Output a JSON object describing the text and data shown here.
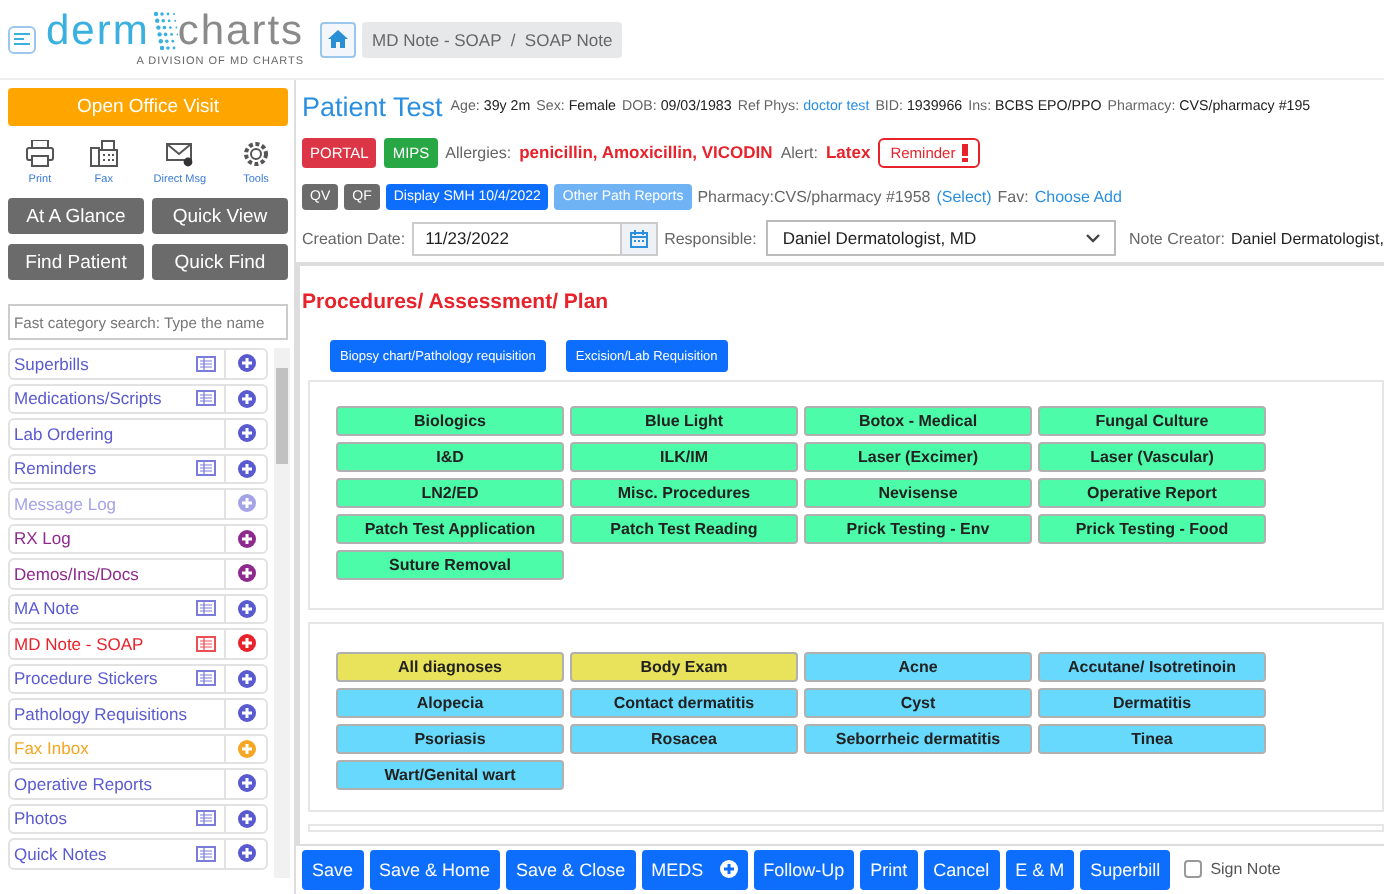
{
  "header": {
    "logo_left": "derm",
    "logo_right": "charts",
    "logo_tagline": "A DIVISION OF MD CHARTS",
    "breadcrumb": "MD Note - SOAP  /  SOAP Note"
  },
  "sidebar": {
    "open_visit": "Open Office Visit",
    "tools": [
      {
        "label": "Print",
        "kind": "print"
      },
      {
        "label": "Fax",
        "kind": "fax"
      },
      {
        "label": "Direct Msg",
        "kind": "mail"
      },
      {
        "label": "Tools",
        "kind": "gear"
      }
    ],
    "nav_buttons": [
      "At A Glance",
      "Quick View",
      "Find Patient",
      "Quick Find"
    ],
    "search": {
      "placeholder": "Fast category search: Type the name"
    },
    "items": [
      {
        "label": "Superbills",
        "color": "#5a5ad0",
        "list_icon": true
      },
      {
        "label": "Medications/Scripts",
        "color": "#5a5ad0",
        "list_icon": true
      },
      {
        "label": "Lab Ordering",
        "color": "#5a5ad0",
        "list_icon": false
      },
      {
        "label": "Reminders",
        "color": "#5a5ad0",
        "list_icon": true
      },
      {
        "label": "Message Log",
        "color": "#a3a3e6",
        "list_icon": false
      },
      {
        "label": "RX Log",
        "color": "#8e2a8e",
        "list_icon": false
      },
      {
        "label": "Demos/Ins/Docs",
        "color": "#8e2a8e",
        "list_icon": false
      },
      {
        "label": "MA Note",
        "color": "#5a5ad0",
        "list_icon": true
      },
      {
        "label": "MD Note - SOAP",
        "color": "#e8222b",
        "list_icon": true
      },
      {
        "label": "Procedure Stickers",
        "color": "#5a5ad0",
        "list_icon": true
      },
      {
        "label": "Pathology Requisitions",
        "color": "#5a5ad0",
        "list_icon": false
      },
      {
        "label": "Fax Inbox",
        "color": "#f5a623",
        "list_icon": false
      },
      {
        "label": "Operative Reports",
        "color": "#5a5ad0",
        "list_icon": false
      },
      {
        "label": "Photos",
        "color": "#5a5ad0",
        "list_icon": true
      },
      {
        "label": "Quick Notes",
        "color": "#5a5ad0",
        "list_icon": true
      }
    ]
  },
  "patient": {
    "name": "Patient Test",
    "fields": [
      {
        "label": "Age:",
        "value": "39y 2m",
        "kind": "plain"
      },
      {
        "label": "Sex:",
        "value": "Female",
        "kind": "plain"
      },
      {
        "label": "DOB:",
        "value": "09/03/1983",
        "kind": "plain"
      },
      {
        "label": "Ref Phys:",
        "value": "doctor test",
        "kind": "link"
      },
      {
        "label": "BID:",
        "value": "1939966",
        "kind": "plain"
      },
      {
        "label": "Ins:",
        "value": "BCBS EPO/PPO",
        "kind": "plain"
      },
      {
        "label": "Pharmacy:",
        "value": "CVS/pharmacy #195",
        "kind": "plain"
      }
    ],
    "badges": [
      {
        "label": "PORTAL",
        "color": "#dc3545"
      },
      {
        "label": "MIPS",
        "color": "#28a745"
      }
    ],
    "allergies_label": "Allergies:",
    "allergies": "penicillin, Amoxicillin, VICODIN",
    "alert_label": "Alert:",
    "alert": "Latex",
    "reminder": "Reminder"
  },
  "actions": {
    "buttons": [
      {
        "label": "QV",
        "kind": "gray"
      },
      {
        "label": "QF",
        "kind": "gray"
      },
      {
        "label": "Display SMH 10/4/2022",
        "kind": "blue"
      },
      {
        "label": "Other Path Reports",
        "kind": "light"
      }
    ],
    "pharmacy": "Pharmacy:CVS/pharmacy #1958",
    "select_link": "(Select)",
    "fav_label": "Fav:",
    "fav_link": "Choose Add"
  },
  "note": {
    "creation_label": "Creation Date:",
    "creation_date": "11/23/2022",
    "responsible_label": "Responsible:",
    "responsible": "Daniel Dermatologist, MD",
    "creator_label": "Note Creator:",
    "creator": "Daniel Dermatologist,"
  },
  "content": {
    "title": "Procedures/ Assessment/ Plan",
    "requisitions": [
      "Biopsy chart/Pathology requisition",
      "Excision/Lab Requisition"
    ],
    "procedures": [
      {
        "label": "Biologics",
        "color": "#4cfca9"
      },
      {
        "label": "Blue Light",
        "color": "#4cfca9"
      },
      {
        "label": "Botox - Medical",
        "color": "#4cfca9"
      },
      {
        "label": "Fungal Culture",
        "color": "#4cfca9"
      },
      {
        "label": "I&D",
        "color": "#4cfca9"
      },
      {
        "label": "ILK/IM",
        "color": "#4cfca9"
      },
      {
        "label": "Laser (Excimer)",
        "color": "#4cfca9"
      },
      {
        "label": "Laser (Vascular)",
        "color": "#4cfca9"
      },
      {
        "label": "LN2/ED",
        "color": "#4cfca9"
      },
      {
        "label": "Misc. Procedures",
        "color": "#4cfca9"
      },
      {
        "label": "Nevisense",
        "color": "#4cfca9"
      },
      {
        "label": "Operative Report",
        "color": "#4cfca9"
      },
      {
        "label": "Patch Test Application",
        "color": "#4cfca9"
      },
      {
        "label": "Patch Test Reading",
        "color": "#4cfca9"
      },
      {
        "label": "Prick Testing - Env",
        "color": "#4cfca9"
      },
      {
        "label": "Prick Testing - Food",
        "color": "#4cfca9"
      },
      {
        "label": "Suture Removal",
        "color": "#4cfca9"
      }
    ],
    "diagnoses": [
      {
        "label": "All diagnoses",
        "color": "#e8e35a"
      },
      {
        "label": "Body Exam",
        "color": "#e8e35a"
      },
      {
        "label": "Acne",
        "color": "#66d9fc"
      },
      {
        "label": "Accutane/ Isotretinoin",
        "color": "#66d9fc"
      },
      {
        "label": "Alopecia",
        "color": "#66d9fc"
      },
      {
        "label": "Contact dermatitis",
        "color": "#66d9fc"
      },
      {
        "label": "Cyst",
        "color": "#66d9fc"
      },
      {
        "label": "Dermatitis",
        "color": "#66d9fc"
      },
      {
        "label": "Psoriasis",
        "color": "#66d9fc"
      },
      {
        "label": "Rosacea",
        "color": "#66d9fc"
      },
      {
        "label": "Seborrheic dermatitis",
        "color": "#66d9fc"
      },
      {
        "label": "Tinea",
        "color": "#66d9fc"
      },
      {
        "label": "Wart/Genital wart",
        "color": "#66d9fc"
      }
    ]
  },
  "toolbar": {
    "buttons": [
      {
        "label": "Save",
        "kind": "plain"
      },
      {
        "label": "Save & Home",
        "kind": "plain"
      },
      {
        "label": "Save & Close",
        "kind": "plain"
      },
      {
        "label": "MEDS",
        "kind": "add"
      },
      {
        "label": "Follow-Up",
        "kind": "plain"
      },
      {
        "label": "Print",
        "kind": "plain"
      },
      {
        "label": "Cancel",
        "kind": "plain"
      },
      {
        "label": "E & M",
        "kind": "plain"
      },
      {
        "label": "Superbill",
        "kind": "plain"
      }
    ],
    "sign_note": {
      "label": "Sign Note",
      "checked": false
    }
  }
}
